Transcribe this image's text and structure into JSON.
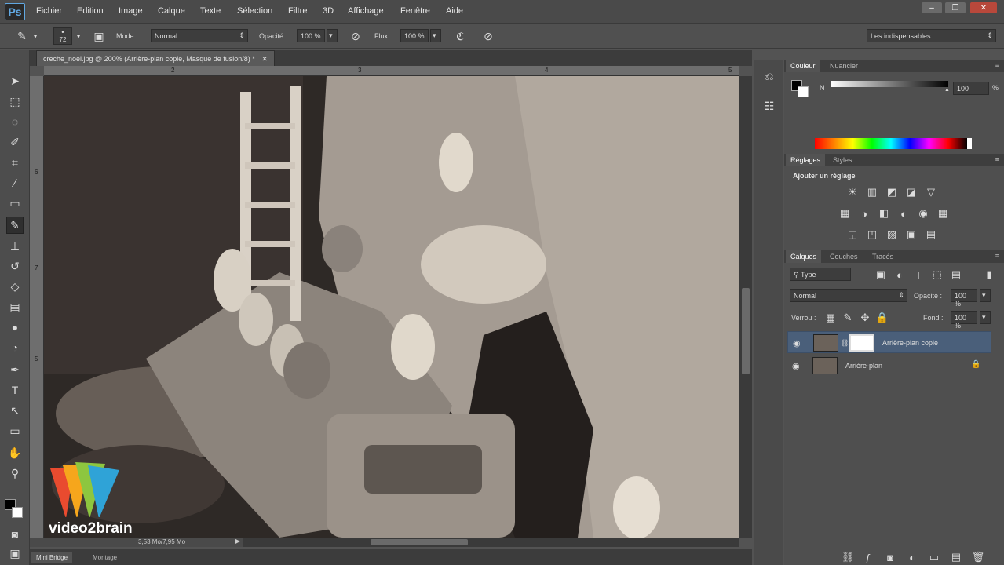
{
  "menu": {
    "app_icon": "Ps",
    "items": [
      "Fichier",
      "Edition",
      "Image",
      "Calque",
      "Texte",
      "Sélection",
      "Filtre",
      "3D",
      "Affichage",
      "Fenêtre",
      "Aide"
    ]
  },
  "options": {
    "brush_size": "72",
    "mode_label": "Mode :",
    "mode_value": "Normal",
    "opacity_label": "Opacité :",
    "opacity_value": "100 %",
    "flow_label": "Flux :",
    "flow_value": "100 %",
    "workspace": "Les indispensables"
  },
  "document": {
    "tab_title": "creche_noel.jpg @ 200% (Arrière-plan copie, Masque de fusion/8) *",
    "ruler_top": [
      "2",
      "3",
      "4",
      "5"
    ],
    "ruler_left": [
      "6",
      "7",
      "5"
    ],
    "status": "3,53 Mo/7,95 Mo"
  },
  "bottom_tabs": [
    "Mini Bridge",
    "Montage"
  ],
  "watermark": "video2brain",
  "panels": {
    "color": {
      "tabs": [
        "Couleur",
        "Nuancier"
      ],
      "channel_label": "N",
      "value": "100",
      "unit": "%"
    },
    "adjustments": {
      "tabs": [
        "Réglages",
        "Styles"
      ],
      "heading": "Ajouter un réglage"
    },
    "layers": {
      "tabs": [
        "Calques",
        "Couches",
        "Tracés"
      ],
      "filter_type": "Type",
      "blend_mode": "Normal",
      "opacity_label": "Opacité :",
      "opacity_value": "100 %",
      "lock_label": "Verrou :",
      "fill_label": "Fond :",
      "fill_value": "100 %",
      "items": [
        {
          "name": "Arrière-plan copie",
          "selected": true
        },
        {
          "name": "Arrière-plan",
          "selected": false
        }
      ]
    }
  },
  "colors": {
    "accent": "#61a8e2",
    "selected_layer": "#4a5f7a"
  }
}
